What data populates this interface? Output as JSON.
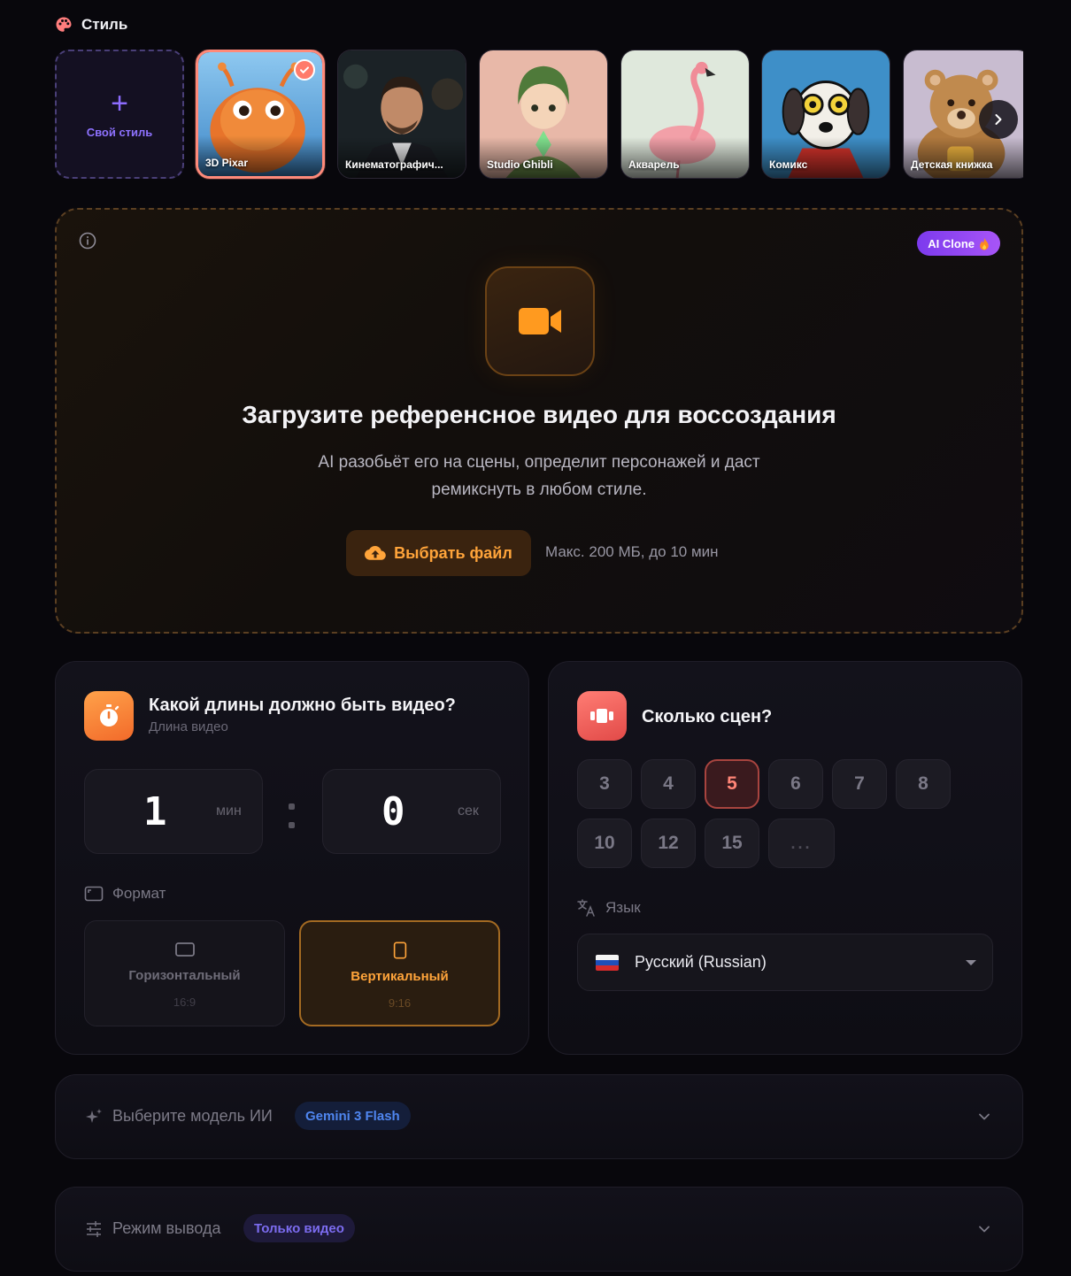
{
  "style_section": {
    "title": "Стиль",
    "custom_label": "Свой стиль",
    "cards": [
      {
        "label": "3D Pixar",
        "selected": true
      },
      {
        "label": "Кинематографич..."
      },
      {
        "label": "Studio Ghibli"
      },
      {
        "label": "Акварель"
      },
      {
        "label": "Комикс"
      },
      {
        "label": "Детская книжка"
      }
    ]
  },
  "upload": {
    "badge": "AI Clone",
    "title": "Загрузите референсное видео для воссоздания",
    "desc_line1": "AI разобьёт его на сцены, определит персонажей и даст",
    "desc_line2": "ремикснуть в любом стиле.",
    "button": "Выбрать файл",
    "limit": "Макс. 200 МБ, до 10 мин"
  },
  "duration": {
    "title": "Какой длины должно быть видео?",
    "subtitle": "Длина видео",
    "minutes": "1",
    "minutes_unit": "мин",
    "seconds": "0",
    "seconds_unit": "сек"
  },
  "format": {
    "label": "Формат",
    "options": [
      {
        "label": "Горизонтальный",
        "ratio": "16:9",
        "active": false
      },
      {
        "label": "Вертикальный",
        "ratio": "9:16",
        "active": true
      }
    ]
  },
  "scenes": {
    "title": "Сколько сцен?",
    "options": [
      "3",
      "4",
      "5",
      "6",
      "7",
      "8",
      "10",
      "12",
      "15",
      "..."
    ],
    "selected": "5"
  },
  "language": {
    "label": "Язык",
    "selected": "Русский (Russian)"
  },
  "model": {
    "label": "Выберите модель ИИ",
    "value": "Gemini 3 Flash"
  },
  "output": {
    "label": "Режим вывода",
    "value": "Только видео"
  },
  "colors": {
    "accent_orange": "#ffa43a",
    "accent_purple": "#8d6cff",
    "accent_red": "#ff7b6a"
  }
}
